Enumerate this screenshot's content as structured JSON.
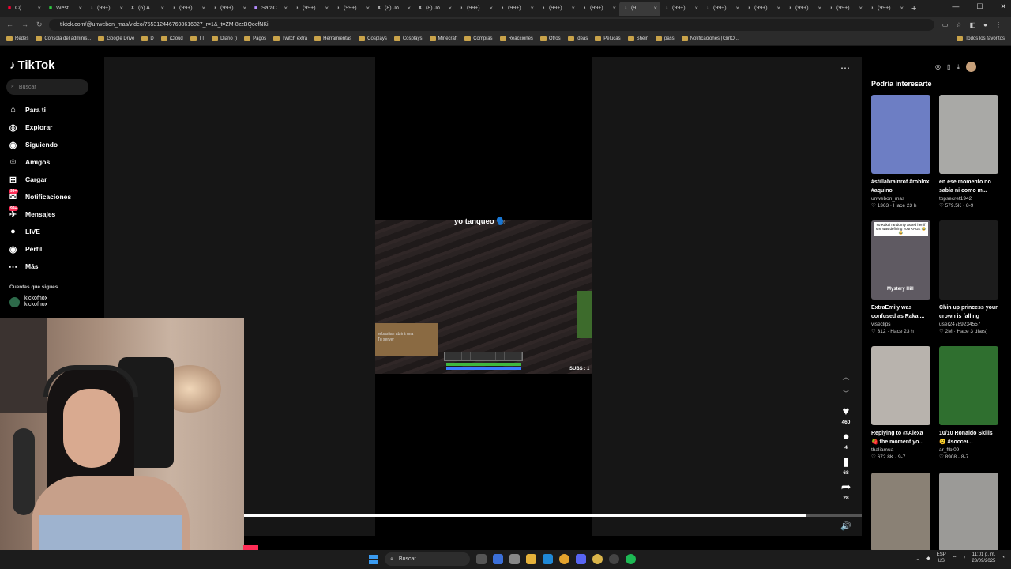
{
  "browser": {
    "tabs": [
      {
        "label": "C(",
        "favicon": "youtube-icon",
        "color": "#ff0033",
        "active": false
      },
      {
        "label": "West",
        "favicon": "green-icon",
        "color": "#2ecc40",
        "active": false
      },
      {
        "label": "(99+)",
        "favicon": "tiktok-icon",
        "color": "#ffffff",
        "active": false
      },
      {
        "label": "(6) A",
        "favicon": "x-icon",
        "color": "#ffffff",
        "active": false
      },
      {
        "label": "(99+)",
        "favicon": "tiktok-icon",
        "color": "#ffffff",
        "active": false
      },
      {
        "label": "(99+)",
        "favicon": "tiktok-icon",
        "color": "#ffffff",
        "active": false
      },
      {
        "label": "SaraC",
        "favicon": "twitch-icon",
        "color": "#b48cff",
        "active": false
      },
      {
        "label": "(99+)",
        "favicon": "tiktok-icon",
        "color": "#ffffff",
        "active": false
      },
      {
        "label": "(99+)",
        "favicon": "tiktok-icon",
        "color": "#ffffff",
        "active": false
      },
      {
        "label": "(8) Jo",
        "favicon": "x-icon",
        "color": "#ffffff",
        "active": false
      },
      {
        "label": "(8) Jo",
        "favicon": "x-icon",
        "color": "#ffffff",
        "active": false
      },
      {
        "label": "(99+)",
        "favicon": "tiktok-icon",
        "color": "#ffffff",
        "active": false
      },
      {
        "label": "(99+)",
        "favicon": "tiktok-icon",
        "color": "#ffffff",
        "active": false
      },
      {
        "label": "(99+)",
        "favicon": "tiktok-icon",
        "color": "#ffffff",
        "active": false
      },
      {
        "label": "(99+)",
        "favicon": "tiktok-icon",
        "color": "#ffffff",
        "active": false
      },
      {
        "label": "(9",
        "favicon": "tiktok-icon",
        "color": "#ffffff",
        "active": true
      },
      {
        "label": "(99+)",
        "favicon": "tiktok-icon",
        "color": "#ffffff",
        "active": false
      },
      {
        "label": "(99+)",
        "favicon": "tiktok-icon",
        "color": "#ffffff",
        "active": false
      },
      {
        "label": "(99+)",
        "favicon": "tiktok-icon",
        "color": "#ffffff",
        "active": false
      },
      {
        "label": "(99+)",
        "favicon": "tiktok-icon",
        "color": "#ffffff",
        "active": false
      },
      {
        "label": "(99+)",
        "favicon": "tiktok-icon",
        "color": "#ffffff",
        "active": false
      },
      {
        "label": "(99+)",
        "favicon": "tiktok-icon",
        "color": "#ffffff",
        "active": false
      }
    ],
    "url": "tiktok.com/@unwebon_mas/video/7553124467698616827_r=1&_t=ZM-8zzBQocfNKi",
    "bookmarks": [
      "Redes",
      "Consola del adminis...",
      "Google Drive",
      "D",
      "iCloud",
      "TT",
      "Diario :)",
      "Pagos",
      "Twitch extra",
      "Herramientas",
      "Cosplays",
      "Cosplays",
      "Minecraft",
      "Compras",
      "Reacciones",
      "Otros",
      "Ideas",
      "Pelucas",
      "Shein",
      "pass",
      "Notificaciones | GirlO..."
    ],
    "bookmarks_all": "Todos los favoritos"
  },
  "sidebar": {
    "logo": "TikTok",
    "search_placeholder": "Buscar",
    "items": [
      {
        "label": "Para ti",
        "icon": "home-icon"
      },
      {
        "label": "Explorar",
        "icon": "compass-icon"
      },
      {
        "label": "Siguiendo",
        "icon": "following-icon"
      },
      {
        "label": "Amigos",
        "icon": "friends-icon"
      },
      {
        "label": "Cargar",
        "icon": "upload-icon"
      },
      {
        "label": "Notificaciones",
        "icon": "bell-icon",
        "badge": "99+"
      },
      {
        "label": "Mensajes",
        "icon": "message-icon",
        "badge": "99+"
      },
      {
        "label": "LIVE",
        "icon": "live-icon"
      },
      {
        "label": "Perfil",
        "icon": "profile-icon"
      },
      {
        "label": "Más",
        "icon": "more-icon"
      }
    ],
    "follows_title": "Cuentas que sigues",
    "follows": [
      {
        "name": "kickofnox",
        "handle": "kickofnox_"
      }
    ]
  },
  "video": {
    "caption": "yo tanqueo 🗣️",
    "subs_overlay": "SUBS : 1",
    "chat_lines": [
      "sebastian abrirá una",
      "Tu server"
    ],
    "hotbar_text": "29 / 1886"
  },
  "actions": {
    "likes": "460",
    "comments": "4",
    "saves": "68",
    "shares": "28"
  },
  "progress_fraction": 0.91,
  "right_panel": {
    "title": "Podría interesarte",
    "cards": [
      {
        "title": "#stillabrainrot #roblox #aquino",
        "user": "unwebon_mas",
        "meta": "♡ 1363 · Hace 23 h",
        "color": "#6d7ec4"
      },
      {
        "title": "en ese momento no sabía ni como m...",
        "user": "topsecret1942",
        "meta": "♡ 579.5K · 8-9",
        "color": "#a9a9a6"
      },
      {
        "title": "ExtraEmily was confused as Rakai...",
        "user": "viseclips",
        "meta": "♡ 312 · Hace 23 h",
        "color": "#5f5a62"
      },
      {
        "title": "Chin up princess your crown is falling",
        "user": "user24789234557",
        "meta": "♡ 2M · Hace 3 día(s)",
        "color": "#1c1c1c"
      },
      {
        "title": "Replying to @Alexa 🍓 the moment yo...",
        "user": "thaliamua",
        "meta": "♡ 672.8K · 9-7",
        "color": "#b8b3ad"
      },
      {
        "title": "10/10 Ronaldo Skills 😮 #soccer...",
        "user": "ar_ftbl09",
        "meta": "♡ 8908 · 8-7",
        "color": "#2f6f2f"
      },
      {
        "title": "",
        "user": "",
        "meta": "",
        "color": "#8a8175"
      },
      {
        "title": "",
        "user": "",
        "meta": "",
        "color": "#9b9a97"
      }
    ],
    "overlay_texts": [
      "so Rakai randomly asked her if she was defining YourRAGE 😂😂",
      "Mystery Hill"
    ]
  },
  "taskbar": {
    "search": "Buscar",
    "lang": "ESP",
    "region": "US",
    "time": "11:01 p. m.",
    "date": "23/09/2025"
  },
  "colors": {
    "accent": "#fe2c55",
    "background": "#000000"
  }
}
